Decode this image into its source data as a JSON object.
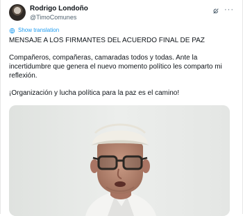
{
  "author": {
    "display_name": "Rodrigo Londoño",
    "handle": "@TimoComunes"
  },
  "header_icons": {
    "grok": "grok-icon",
    "more": "more-icon",
    "more_glyph": "···"
  },
  "translation": {
    "label": "Show translation",
    "icon": "globe-icon"
  },
  "tweet": {
    "paragraphs": [
      "MENSAJE A LOS FIRMANTES DEL ACUERDO FINAL DE PAZ",
      "Compañeros, compañeras, camaradas todos y todas. Ante la incertidumbre que genera el nuevo momento político les comparto mi reflexión.",
      "¡Organización y lucha política para la paz es el camino!"
    ]
  },
  "media": {
    "type": "video-thumbnail"
  },
  "colors": {
    "text": "#0f1419",
    "secondary": "#536471",
    "link": "#1d9bf0"
  }
}
